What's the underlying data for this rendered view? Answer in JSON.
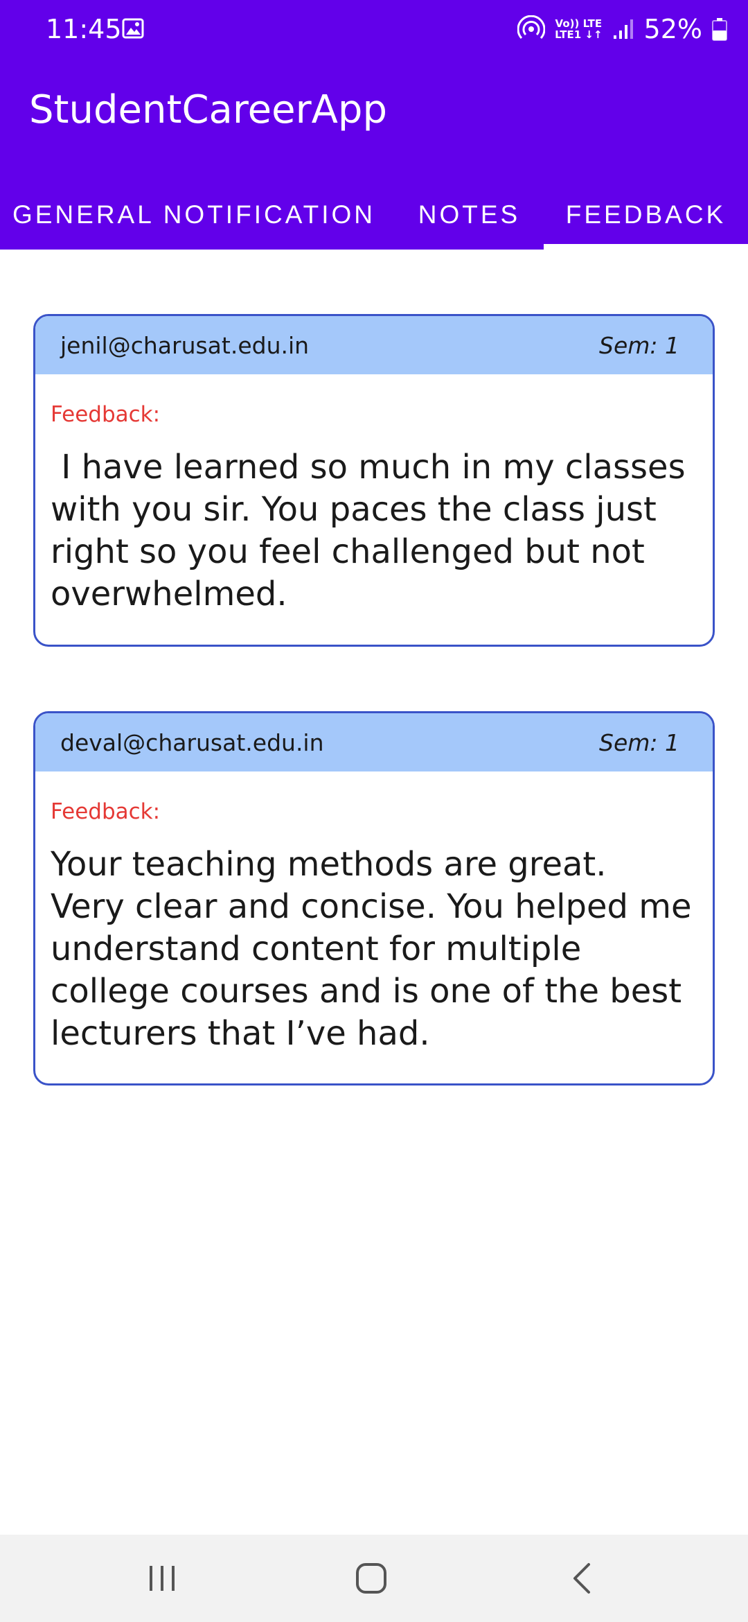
{
  "status_bar": {
    "time": "11:45",
    "network_top": "Vo)) LTE",
    "network_bottom": "LTE1 ↓↑",
    "battery": "52%"
  },
  "app": {
    "title": "StudentCareerApp"
  },
  "tabs": [
    {
      "label": "GENERAL NOTIFICATION",
      "selected": false
    },
    {
      "label": "NOTES",
      "selected": false
    },
    {
      "label": "FEEDBACK",
      "selected": true
    }
  ],
  "feedback": [
    {
      "email": "jenil@charusat.edu.in",
      "sem": "Sem: 1",
      "label": "Feedback:",
      "text": " I have learned so much in my classes with you sir. You paces the class just right so you feel challenged but not overwhelmed."
    },
    {
      "email": "deval@charusat.edu.in",
      "sem": "Sem: 1",
      "label": "Feedback:",
      "text": "Your teaching methods are great.\nVery clear and concise. You helped me understand content for multiple college courses and is one of the best lecturers that I’ve had."
    }
  ],
  "colors": {
    "app_bar": "#6200ea",
    "card_header": "#a4c8fa",
    "card_border": "#3a53c8",
    "feedback_label": "#e53935"
  },
  "nav_bar": {
    "icons": [
      "recents-icon",
      "home-icon",
      "back-icon"
    ]
  }
}
